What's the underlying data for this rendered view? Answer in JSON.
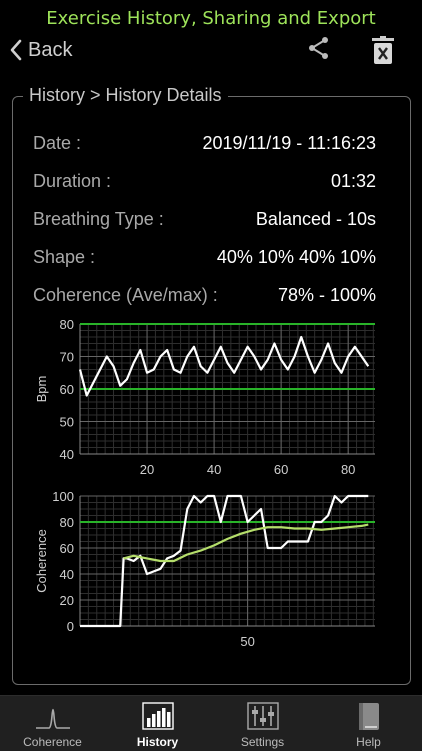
{
  "banner": "Exercise History, Sharing and Export",
  "nav": {
    "back_label": "Back"
  },
  "panel": {
    "breadcrumb": "History > History Details",
    "details": [
      {
        "label": "Date :",
        "value": "2019/11/19 - 11:16:23"
      },
      {
        "label": "Duration :",
        "value": "01:32"
      },
      {
        "label": "Breathing Type :",
        "value": "Balanced - 10s"
      },
      {
        "label": "Shape :",
        "value": "40% 10% 40% 10%"
      },
      {
        "label": "Coherence (Ave/max) :",
        "value": "78% - 100%"
      }
    ]
  },
  "chart_data": [
    {
      "type": "line",
      "ylabel": "Bpm",
      "ylim": [
        40,
        80
      ],
      "yticks": [
        "80",
        "70",
        "60",
        "50",
        "40"
      ],
      "xlim": [
        0,
        88
      ],
      "xticks": [
        "20",
        "40",
        "60",
        "80"
      ],
      "reference_lines": [
        80,
        60
      ],
      "colors": {
        "series": "#ffffff",
        "reference": "#29b329"
      },
      "series": [
        {
          "x": [
            0,
            2,
            4,
            6,
            8,
            10,
            12,
            14,
            16,
            18,
            20,
            22,
            24,
            26,
            28,
            30,
            32,
            34,
            36,
            38,
            40,
            42,
            44,
            46,
            48,
            50,
            52,
            54,
            56,
            58,
            60,
            62,
            64,
            66,
            68,
            70,
            72,
            74,
            76,
            78,
            80,
            82,
            84,
            86
          ],
          "values": [
            66,
            58,
            62,
            66,
            70,
            67,
            61,
            63,
            68,
            72,
            65,
            66,
            70,
            72,
            66,
            65,
            70,
            73,
            67,
            65,
            69,
            73,
            68,
            65,
            69,
            73,
            70,
            66,
            69,
            74,
            69,
            66,
            70,
            76,
            70,
            65,
            69,
            74,
            68,
            65,
            70,
            73,
            70,
            67
          ]
        }
      ]
    },
    {
      "type": "line",
      "ylabel": "Coherence",
      "ylim": [
        0,
        100
      ],
      "yticks": [
        "100",
        "80",
        "60",
        "40",
        "20",
        "0"
      ],
      "xlim": [
        0,
        88
      ],
      "xticks": [
        "50"
      ],
      "reference_lines": [
        80
      ],
      "colors": {
        "coherence": "#ffffff",
        "average": "#b5de6b",
        "reference": "#29b329"
      },
      "series": [
        {
          "x": [
            0,
            4,
            8,
            12,
            13,
            14,
            16,
            18,
            20,
            22,
            24,
            26,
            28,
            30,
            32,
            34,
            36,
            38,
            40,
            42,
            44,
            46,
            48,
            50,
            52,
            54,
            56,
            58,
            60,
            62,
            64,
            66,
            68,
            70,
            72,
            74,
            76,
            78,
            80,
            82,
            84,
            86
          ],
          "values": [
            0,
            0,
            0,
            0,
            52,
            52,
            50,
            54,
            40,
            42,
            44,
            52,
            54,
            58,
            90,
            100,
            95,
            100,
            100,
            80,
            100,
            100,
            100,
            80,
            85,
            90,
            60,
            60,
            60,
            65,
            65,
            65,
            65,
            80,
            80,
            85,
            100,
            95,
            100,
            100,
            100,
            100
          ]
        },
        {
          "x": [
            13,
            16,
            20,
            24,
            28,
            32,
            36,
            40,
            44,
            48,
            52,
            56,
            60,
            64,
            68,
            72,
            76,
            80,
            84,
            86
          ],
          "values": [
            52,
            54,
            52,
            50,
            50,
            55,
            58,
            62,
            67,
            71,
            74,
            76,
            76,
            75,
            75,
            74,
            75,
            76,
            77,
            78
          ]
        }
      ]
    }
  ],
  "tabs": [
    {
      "label": "Coherence",
      "icon": "coherence-peak-icon"
    },
    {
      "label": "History",
      "icon": "history-bars-icon"
    },
    {
      "label": "Settings",
      "icon": "settings-sliders-icon"
    },
    {
      "label": "Help",
      "icon": "help-book-icon"
    }
  ]
}
